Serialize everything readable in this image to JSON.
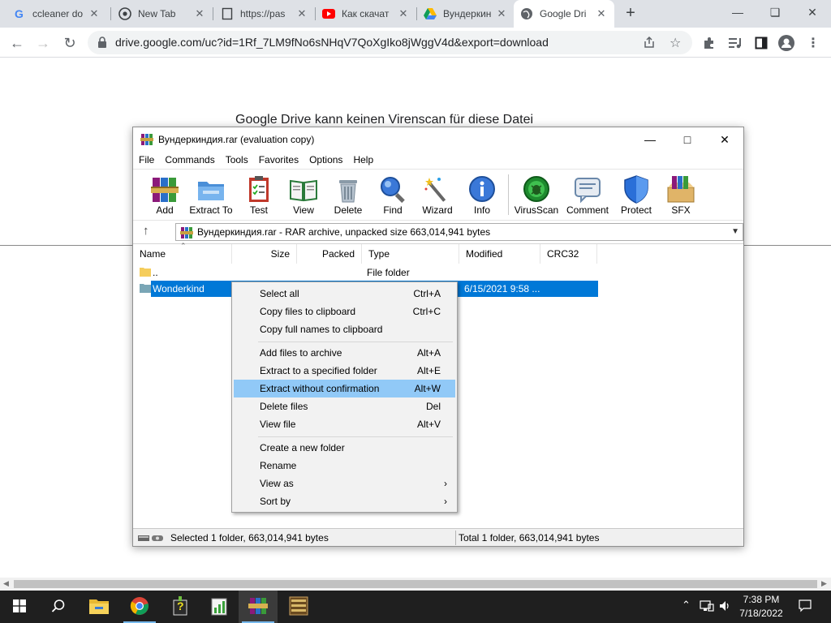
{
  "browser": {
    "tabs": [
      {
        "title": "ccleaner do",
        "icon": "google-g-icon"
      },
      {
        "title": "New Tab",
        "icon": "chrome-icon"
      },
      {
        "title": "https://pas",
        "icon": "page-icon"
      },
      {
        "title": "Как скачат",
        "icon": "youtube-icon"
      },
      {
        "title": "Вундеркин",
        "icon": "google-drive-icon"
      },
      {
        "title": "Google Dri",
        "icon": "globe-icon",
        "active": true
      }
    ],
    "new_tab": "+",
    "url": "drive.google.com/uc?id=1Rf_7LM9fNo6sNHqV7QoXgIko8jWggV4d&export=download"
  },
  "page": {
    "heading": "Google Drive kann keinen Virenscan für diese Datei"
  },
  "winrar": {
    "title": "Вундеркиндия.rar (evaluation copy)",
    "menu": [
      "File",
      "Commands",
      "Tools",
      "Favorites",
      "Options",
      "Help"
    ],
    "tools": [
      {
        "label": "Add",
        "icon": "add-archive-icon"
      },
      {
        "label": "Extract To",
        "icon": "extract-folder-icon"
      },
      {
        "label": "Test",
        "icon": "test-clipboard-icon"
      },
      {
        "label": "View",
        "icon": "view-book-icon"
      },
      {
        "label": "Delete",
        "icon": "trash-icon"
      },
      {
        "label": "Find",
        "icon": "magnifier-icon"
      },
      {
        "label": "Wizard",
        "icon": "wand-icon"
      },
      {
        "label": "Info",
        "icon": "info-icon"
      },
      {
        "label": "VirusScan",
        "icon": "virus-icon"
      },
      {
        "label": "Comment",
        "icon": "comment-icon"
      },
      {
        "label": "Protect",
        "icon": "shield-icon"
      },
      {
        "label": "SFX",
        "icon": "sfx-box-icon"
      }
    ],
    "path": "Вундеркиндия.rar - RAR archive, unpacked size 663,014,941 bytes",
    "columns": [
      "Name",
      "Size",
      "Packed",
      "Type",
      "Modified",
      "CRC32"
    ],
    "rows": [
      {
        "name": "..",
        "size": "",
        "packed": "",
        "type": "File folder",
        "modified": "",
        "crc": ""
      },
      {
        "name": "Wonderkind",
        "size": "",
        "packed": "",
        "type": "",
        "modified": "6/15/2021 9:58 ...",
        "crc": "",
        "selected": true
      }
    ],
    "status_left": "Selected 1 folder, 663,014,941 bytes",
    "status_right": "Total 1 folder, 663,014,941 bytes"
  },
  "context_menu": {
    "groups": [
      [
        {
          "label": "Select all",
          "key": "Ctrl+A"
        },
        {
          "label": "Copy files to clipboard",
          "key": "Ctrl+C"
        },
        {
          "label": "Copy full names to clipboard",
          "key": ""
        }
      ],
      [
        {
          "label": "Add files to archive",
          "key": "Alt+A"
        },
        {
          "label": "Extract to a specified folder",
          "key": "Alt+E"
        },
        {
          "label": "Extract without confirmation",
          "key": "Alt+W",
          "highlighted": true
        },
        {
          "label": "Delete files",
          "key": "Del"
        },
        {
          "label": "View file",
          "key": "Alt+V"
        }
      ],
      [
        {
          "label": "Create a new folder",
          "key": ""
        },
        {
          "label": "Rename",
          "key": ""
        },
        {
          "label": "View as",
          "key": "",
          "submenu": true
        },
        {
          "label": "Sort by",
          "key": "",
          "submenu": true
        }
      ]
    ]
  },
  "taskbar": {
    "time": "7:38 PM",
    "date": "7/18/2022"
  },
  "colors": {
    "selection": "#0078d7",
    "menu_highlight": "#91c9f7",
    "taskbar": "#1f1f1f"
  }
}
